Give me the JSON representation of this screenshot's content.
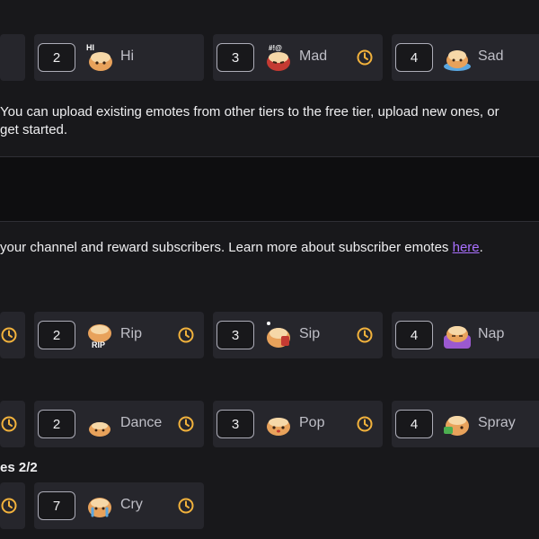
{
  "free_tier": {
    "emotes": [
      {
        "slot": "2",
        "name": "Hi",
        "icon": "bun-hi-emote"
      },
      {
        "slot": "3",
        "name": "Mad",
        "icon": "bun-mad-emote"
      },
      {
        "slot": "4",
        "name": "Sad",
        "icon": "bun-sad-emote"
      }
    ],
    "info_line1": "You can upload existing emotes from other tiers to the free tier, upload new ones, or",
    "info_line2": "get started."
  },
  "subscriber": {
    "info_text": "your channel and reward subscribers. Learn more about subscriber emotes",
    "info_link": "here",
    "info_end": ".",
    "row1": [
      {
        "slot": "2",
        "name": "Rip",
        "icon": "bun-rip-emote"
      },
      {
        "slot": "3",
        "name": "Sip",
        "icon": "bun-sip-emote"
      },
      {
        "slot": "4",
        "name": "Nap",
        "icon": "bun-nap-emote"
      }
    ],
    "row2": [
      {
        "slot": "2",
        "name": "Dance",
        "icon": "bun-dance-emote"
      },
      {
        "slot": "3",
        "name": "Pop",
        "icon": "bun-pop-emote"
      },
      {
        "slot": "4",
        "name": "Spray",
        "icon": "bun-spray-emote"
      }
    ],
    "section_label": "es 2/2",
    "row3": [
      {
        "slot": "7",
        "name": "Cry",
        "icon": "bun-cry-emote"
      }
    ]
  },
  "colors": {
    "accent": "#a970ff",
    "clock": "#f2b23c",
    "card": "#26262c",
    "bg": "#18181b"
  }
}
